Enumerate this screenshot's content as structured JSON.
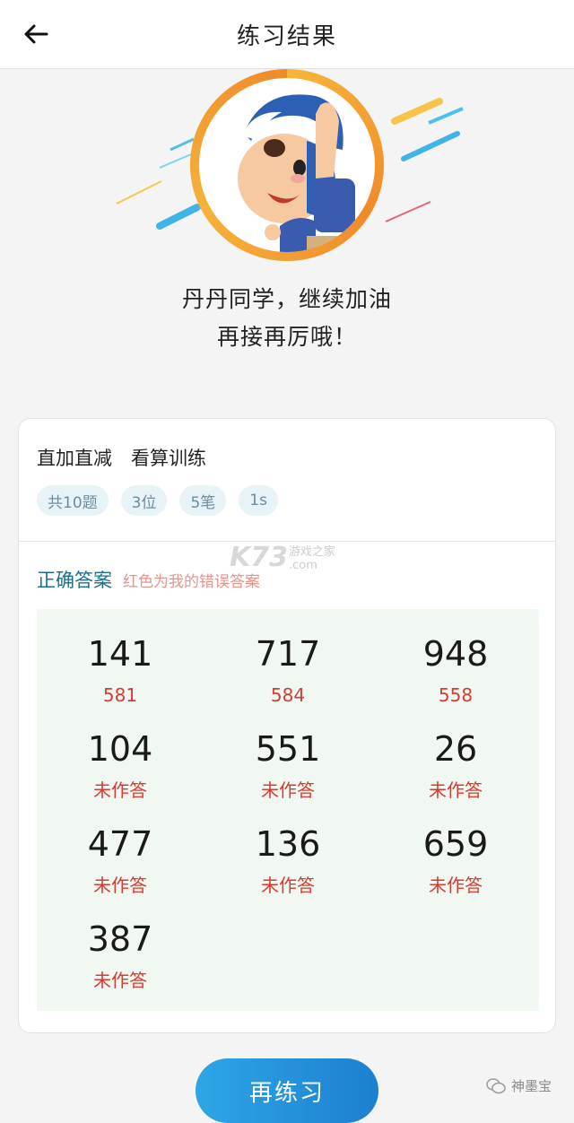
{
  "header": {
    "title": "练习结果",
    "back_icon": "arrow-left-icon"
  },
  "hero": {
    "line1": "丹丹同学，继续加油",
    "line2": "再接再厉哦！"
  },
  "card": {
    "title": "直加直减　看算训练",
    "tags": [
      "共10题",
      "3位",
      "5笔",
      "1s"
    ],
    "legend_main": "正确答案",
    "legend_sub": "红色为我的错误答案",
    "answers": [
      {
        "correct": "141",
        "mine": "581"
      },
      {
        "correct": "717",
        "mine": "584"
      },
      {
        "correct": "948",
        "mine": "558"
      },
      {
        "correct": "104",
        "mine": "未作答"
      },
      {
        "correct": "551",
        "mine": "未作答"
      },
      {
        "correct": "26",
        "mine": "未作答"
      },
      {
        "correct": "477",
        "mine": "未作答"
      },
      {
        "correct": "136",
        "mine": "未作答"
      },
      {
        "correct": "659",
        "mine": "未作答"
      },
      {
        "correct": "387",
        "mine": "未作答"
      }
    ]
  },
  "retry_button": "再练习",
  "watermarks": {
    "k73": "K73",
    "k73_sub1": "游戏之家",
    "k73_sub2": ".com",
    "wechat": "神墨宝"
  },
  "colors": {
    "accent": "#1c6f8c",
    "error": "#d93a32",
    "button": "#1b7fd0"
  }
}
